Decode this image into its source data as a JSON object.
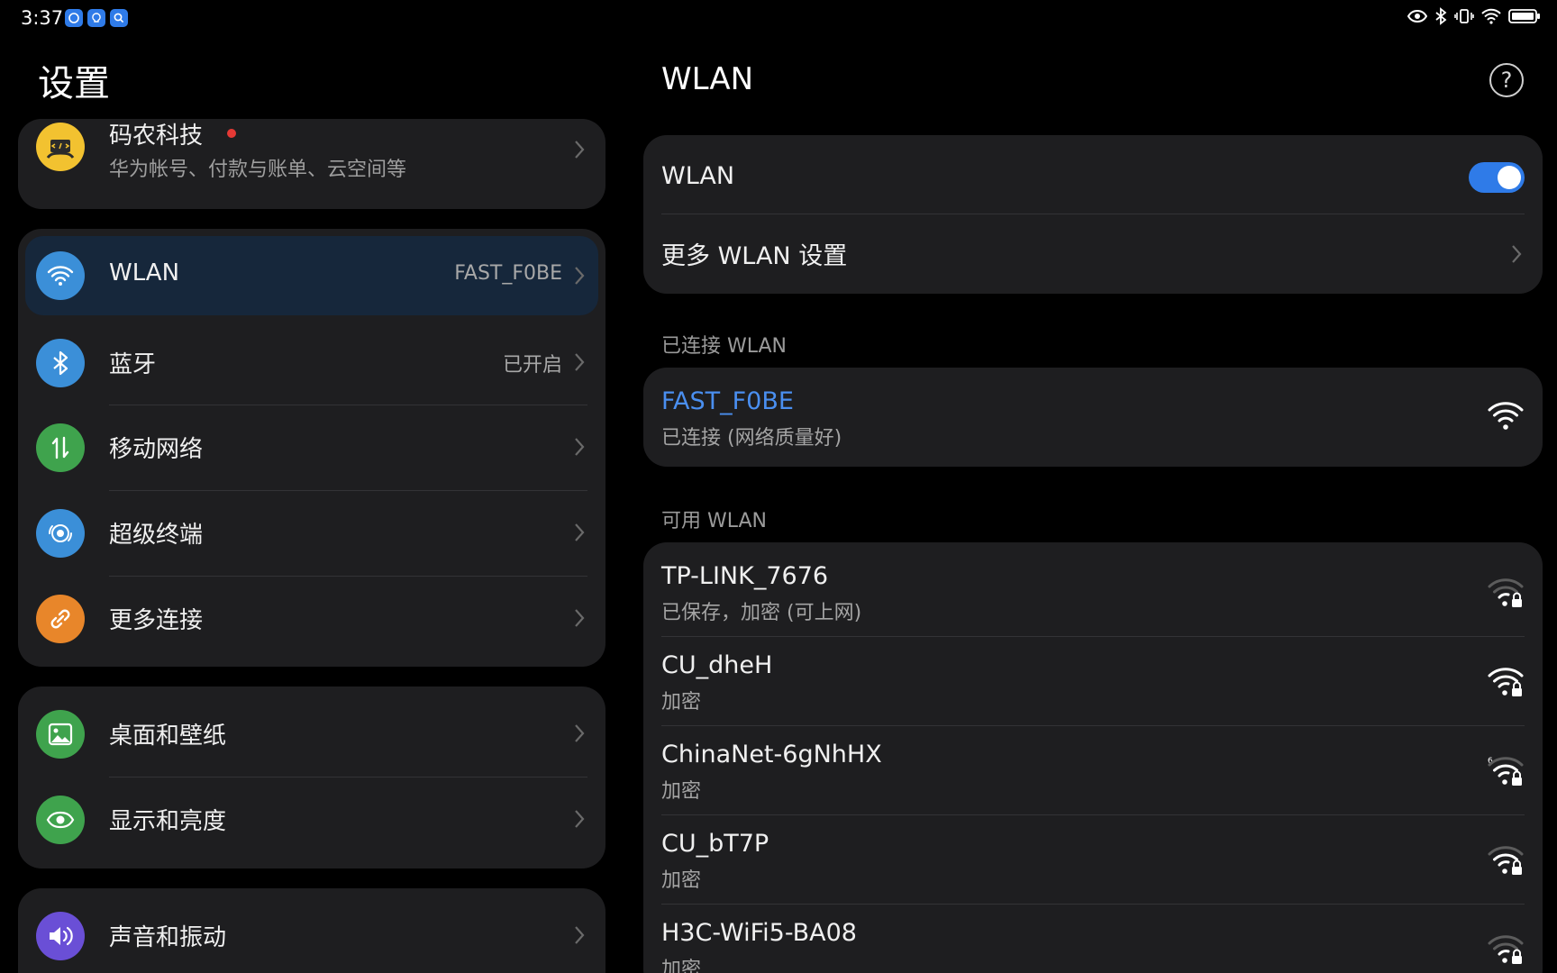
{
  "status_bar": {
    "time": "3:37"
  },
  "left": {
    "title": "设置",
    "account": {
      "name": "码农科技",
      "subtitle": "华为帐号、付款与账单、云空间等"
    },
    "group1": [
      {
        "label": "WLAN",
        "value": "FAST_F0BE",
        "icon": "wifi-icon",
        "color": "#3b8fd8"
      },
      {
        "label": "蓝牙",
        "value": "已开启",
        "icon": "bluetooth-icon",
        "color": "#3b8fd8"
      },
      {
        "label": "移动网络",
        "value": "",
        "icon": "mobile-data-icon",
        "color": "#3fa34d"
      },
      {
        "label": "超级终端",
        "value": "",
        "icon": "super-device-icon",
        "color": "#3b8fd8"
      },
      {
        "label": "更多连接",
        "value": "",
        "icon": "link-icon",
        "color": "#e8862a"
      }
    ],
    "group2": [
      {
        "label": "桌面和壁纸",
        "icon": "wallpaper-icon",
        "color": "#3fa34d"
      },
      {
        "label": "显示和亮度",
        "icon": "eye-icon",
        "color": "#3fa34d"
      }
    ],
    "group3": [
      {
        "label": "声音和振动",
        "icon": "speaker-icon",
        "color": "#6a4fd6"
      }
    ]
  },
  "right": {
    "title": "WLAN",
    "wlan_toggle_label": "WLAN",
    "wlan_enabled": true,
    "more_settings": "更多 WLAN 设置",
    "connected_header": "已连接 WLAN",
    "connected": {
      "ssid": "FAST_F0BE",
      "status": "已连接 (网络质量好)"
    },
    "available_header": "可用 WLAN",
    "available": [
      {
        "ssid": "TP-LINK_7676",
        "status": "已保存，加密 (可上网)",
        "signal": 2
      },
      {
        "ssid": "CU_dheH",
        "status": "加密",
        "signal": 4
      },
      {
        "ssid": "ChinaNet-6gNhHX",
        "status": "加密",
        "signal": 3,
        "badge": "6"
      },
      {
        "ssid": "CU_bT7P",
        "status": "加密",
        "signal": 3
      },
      {
        "ssid": "H3C-WiFi5-BA08",
        "status": "加密",
        "signal": 2
      }
    ],
    "accent": "#4a8ff0"
  }
}
